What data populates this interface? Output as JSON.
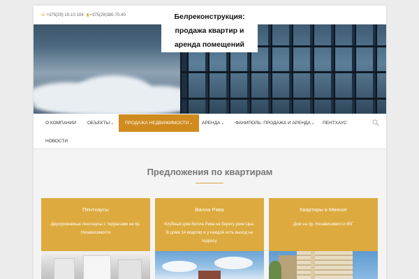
{
  "header": {
    "phone1": "+375(29) 10-10-104",
    "phone2": "+375(29)380-70-40",
    "site_title": "Белреконструкция: продажа квартир и аренда помещений",
    "phone_icon": "phone-icon"
  },
  "nav": {
    "items": [
      {
        "label": "О компании",
        "dropdown": false
      },
      {
        "label": "Объекты",
        "dropdown": true
      },
      {
        "label": "Продажа недвижимости",
        "dropdown": true,
        "active": true
      },
      {
        "label": "Аренда",
        "dropdown": true
      },
      {
        "label": "Фаниполь: продажа и аренда",
        "dropdown": true
      },
      {
        "label": "Пентхаус",
        "dropdown": false
      },
      {
        "label": "Новости",
        "dropdown": false
      }
    ],
    "search_icon": "search-icon",
    "active_color": "#cf8b1e"
  },
  "section": {
    "title": "Предложения по квартирам"
  },
  "cards": [
    {
      "title": "Пентхаусы",
      "desc": "Двухуровневые пентхаусы с террасами на пр. Независимости"
    },
    {
      "title": "Вилла Рива",
      "desc": "Клубный дом Вилла Рива на берегу реки Цна. В доме 14 квартир и у каждой есть выход на террасу."
    },
    {
      "title": "Квартиры в Минске",
      "desc": "Дом на пр. Независимости 85Г"
    }
  ],
  "colors": {
    "card_bg": "#dcaa3e",
    "accent": "#d4a017"
  }
}
